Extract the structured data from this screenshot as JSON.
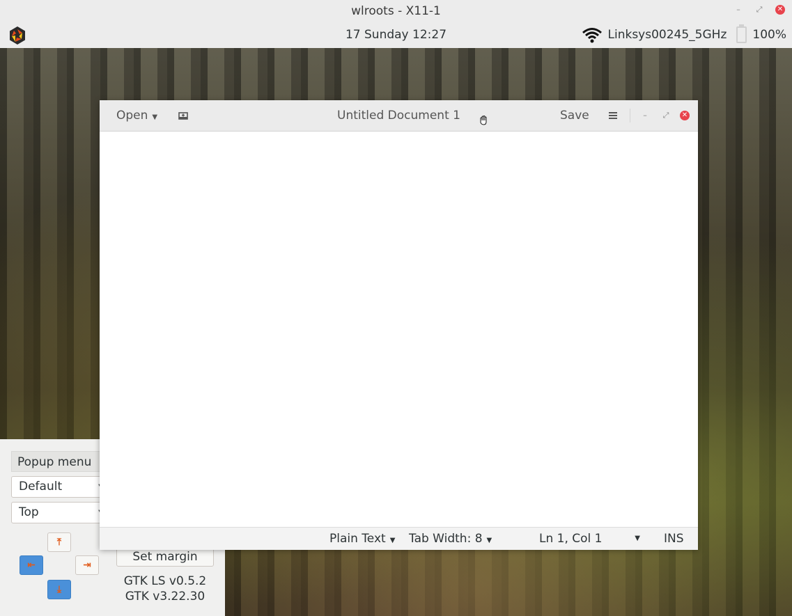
{
  "outer_window": {
    "title": "wlroots - X11-1"
  },
  "panel": {
    "clock": "17 Sunday 12:27",
    "network": "Linksys00245_5GHz",
    "battery": "100%",
    "icons": [
      "app-logo-icon",
      "wifi-icon",
      "battery-icon"
    ]
  },
  "ls_panel": {
    "popup_menu": "Popup menu",
    "layer_combo": "Default",
    "anchor_combo": "Top",
    "set_margin": "Set margin",
    "version_ls": "GTK LS v0.5.2",
    "version_gtk": "GTK v3.22.30",
    "arrow_icons": [
      "anchor-top-icon",
      "anchor-left-icon",
      "anchor-right-icon",
      "anchor-bottom-icon"
    ]
  },
  "gedit": {
    "open_label": "Open",
    "title": "Untitled Document 1",
    "save_label": "Save",
    "status": {
      "language": "Plain Text",
      "tab_width": "Tab Width: 8",
      "position": "Ln 1, Col 1",
      "mode": "INS"
    }
  },
  "colors": {
    "accent": "#4a90d9",
    "close_red": "#e8434c",
    "arrow_orange": "#e05a1a"
  }
}
